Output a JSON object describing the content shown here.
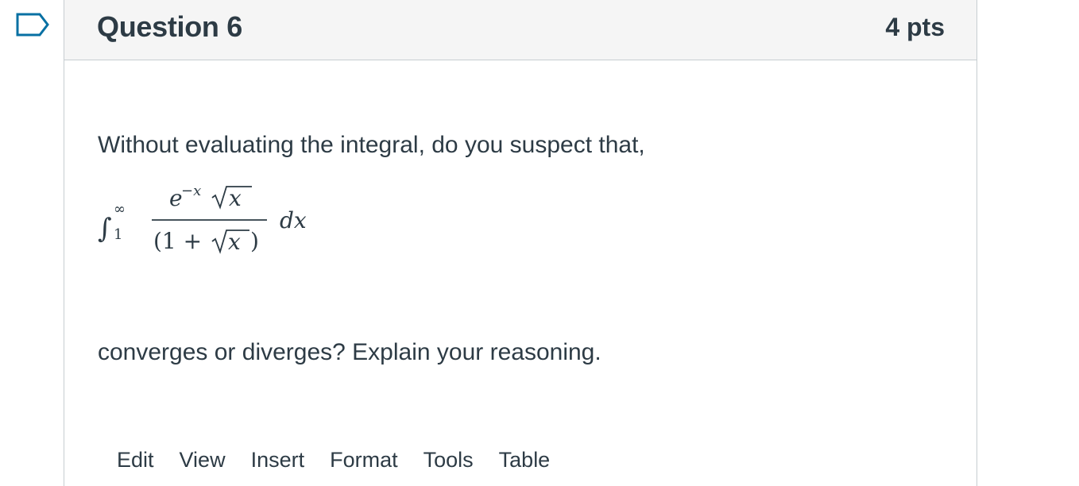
{
  "question": {
    "title": "Question 6",
    "points": "4 pts",
    "prompt_line_1": "Without evaluating the integral, do you suspect that,",
    "prompt_line_2": "converges or diverges? Explain your reasoning.",
    "integral": {
      "lower_limit": "1",
      "upper_limit": "∞",
      "numerator_exp": "e",
      "numerator_exp_power": "−x",
      "numerator_radicand": "x",
      "denominator_open": "(1 + ",
      "denominator_radicand": "x",
      "denominator_close": ")",
      "differential": "dx"
    }
  },
  "editor": {
    "menu": [
      "Edit",
      "View",
      "Insert",
      "Format",
      "Tools",
      "Table"
    ]
  },
  "icons": {
    "flag": "flag-question-icon"
  },
  "colors": {
    "text": "#2d3b45",
    "header_bg": "#f5f5f5",
    "border": "#c7cdd1",
    "flag_stroke": "#0770a3"
  }
}
